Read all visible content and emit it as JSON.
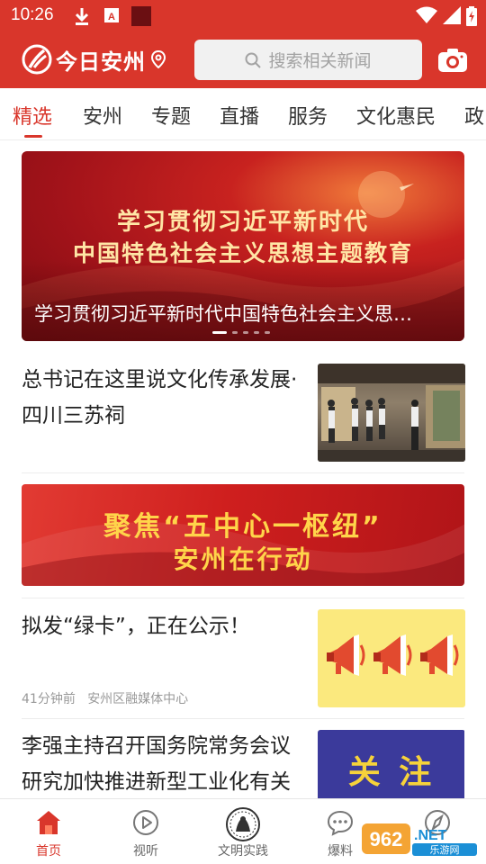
{
  "status_bar": {
    "time": "10:26"
  },
  "header": {
    "app_name": "今日安州",
    "search_placeholder": "搜索相关新闻",
    "brand_color": "#d9362b"
  },
  "tabs": [
    {
      "label": "精选",
      "active": true
    },
    {
      "label": "安州",
      "active": false
    },
    {
      "label": "专题",
      "active": false
    },
    {
      "label": "直播",
      "active": false
    },
    {
      "label": "服务",
      "active": false
    },
    {
      "label": "文化惠民",
      "active": false
    },
    {
      "label": "政",
      "active": false
    }
  ],
  "banner": {
    "line1": "学习贯彻习近平新时代",
    "line2": "中国特色社会主义思想主题教育",
    "caption": "学习贯彻习近平新时代中国特色社会主义思…",
    "slide_count": 5,
    "active_slide": 1
  },
  "news": [
    {
      "title": "总书记在这里说文化传承发展·四川三苏祠"
    },
    {
      "title": "拟发“绿卡”，正在公示！",
      "time": "41分钟前",
      "source": "安州区融媒体中心"
    },
    {
      "title": "李强主持召开国务院常务会议研究加快推进新型工业化有关",
      "thumb_text": "关 注"
    }
  ],
  "ad_banner": {
    "line1": "聚焦“五中心一枢纽”",
    "line2": "安州在行动"
  },
  "bottom_nav": [
    {
      "label": "首页",
      "icon": "home-icon",
      "active": true
    },
    {
      "label": "视听",
      "icon": "play-icon",
      "active": false
    },
    {
      "label": "文明实践",
      "icon": "emblem-icon",
      "active": false
    },
    {
      "label": "爆料",
      "icon": "chat-icon",
      "active": false
    },
    {
      "label": "",
      "icon": "compass-icon",
      "active": false
    }
  ],
  "watermark": "962.NET 乐游网"
}
